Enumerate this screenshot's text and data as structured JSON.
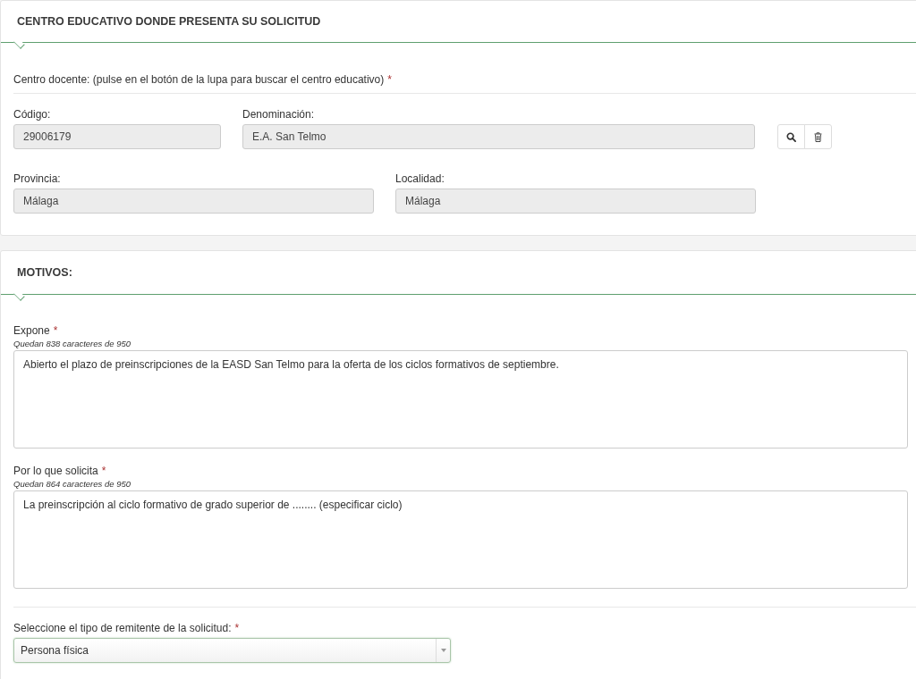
{
  "centro": {
    "title": "CENTRO EDUCATIVO DONDE PRESENTA SU SOLICITUD",
    "instruction": {
      "text": "Centro docente: (pulse en el botón de la lupa para buscar el centro educativo)",
      "required_mark": "*"
    },
    "codigo": {
      "label": "Código:",
      "value": "29006179",
      "disabled": true
    },
    "denominacion": {
      "label": "Denominación:",
      "value": "E.A. San Telmo",
      "disabled": true
    },
    "provincia": {
      "label": "Provincia:",
      "value": "Málaga",
      "disabled": true
    },
    "localidad": {
      "label": "Localidad:",
      "value": "Málaga",
      "disabled": true
    }
  },
  "motivos": {
    "title": "MOTIVOS:",
    "textareas": [
      {
        "label": "Expone",
        "required_mark": "*",
        "hint": "Quedan 838 caracteres de 950",
        "value": "Abierto el plazo de preinscripciones de la EASD San Telmo para la oferta de los ciclos formativos de septiembre."
      },
      {
        "label": "Por lo que solicita",
        "required_mark": "*",
        "hint": "Quedan 864 caracteres de 950",
        "value": "La preinscripción al ciclo formativo de grado superior de ........ (especificar ciclo)"
      }
    ],
    "remitente": {
      "label": "Seleccione el tipo de remitente de la solicitud:",
      "required_mark": "*",
      "value": "Persona física"
    }
  }
}
